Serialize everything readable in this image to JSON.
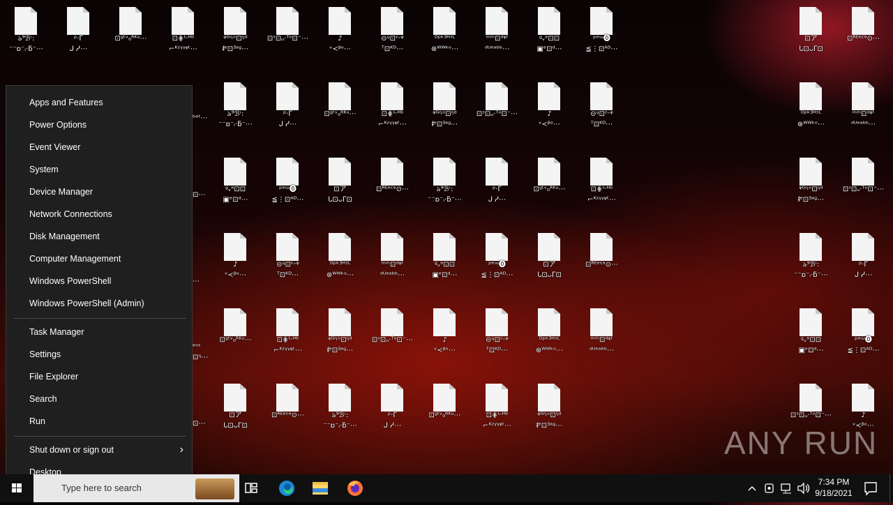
{
  "desktop": {
    "files": [
      {
        "label": "ঌ⁹ℬᶥ:\n⁻⁻ɒ⁻ᵢ·ƃ⁻⋯"
      },
      {
        "label": "ᵖ·ᒥ\nᒍ ᓱ⋯"
      },
      {
        "label": "⊡ᶢᵗᵛ₀ᴿᴷᵘ⋯"
      },
      {
        "label": "⊡⋕ᴵᵕᴴᵇ\n⌐ᴷᶻᵞᵞᵠᵗ⋯"
      },
      {
        "label": "ᵠᴳᶯᵒ⊡ᵑᵈ\nᵮᵉ⊡ᴲᵃᶢ⋯"
      },
      {
        "label": "⊡ᵌ⊡ᵤ·ᵀᵒ⊡⁻⋯"
      },
      {
        "label": "♪\nᵛ≺ᵝᵒ⋯"
      },
      {
        "label": "⊝ᶣ⊡ᵋᵕᵠ\nᵀ⊡ᴷᴰ⋯"
      },
      {
        "label": "ᴰᵖᵏᴲᴴᵌᴸ\n⊛ᵂᵂᵏᵒ⋯"
      },
      {
        "label": "ᵐᵐ⊡ᵈᵠᵗ\nᵈᵁᵉᵃᵇᵇ⋯"
      },
      {
        "label": "ᵍᵥᵊ⊡⊡\n▣ᵉ⊡ᵈ⋯"
      },
      {
        "label": "ᵖᵉᵚ⓿\n≦⋮⊡ᴬᴰ⋯"
      },
      {
        "label": "⊡ア\nᒐ⊡ᴗᒥ⊡"
      },
      {
        "label": "⊡ᴿᴱᵉᵋᵊ⊙⋯"
      }
    ],
    "overlapped_labels": [
      "ᵇᵊᵗ⋯",
      "⊡⋯",
      "⋯",
      "ᵉᵒᵋ\n⊡ᵑ⋯",
      "⊡⋯"
    ]
  },
  "start_menu": {
    "items": [
      {
        "label": "Apps and Features"
      },
      {
        "label": "Power Options"
      },
      {
        "label": "Event Viewer"
      },
      {
        "label": "System"
      },
      {
        "label": "Device Manager"
      },
      {
        "label": "Network Connections"
      },
      {
        "label": "Disk Management"
      },
      {
        "label": "Computer Management"
      },
      {
        "label": "Windows PowerShell"
      },
      {
        "label": "Windows PowerShell (Admin)"
      },
      {
        "label": "Task Manager"
      },
      {
        "label": "Settings"
      },
      {
        "label": "File Explorer"
      },
      {
        "label": "Search"
      },
      {
        "label": "Run"
      },
      {
        "label": "Shut down or sign out"
      },
      {
        "label": "Desktop"
      }
    ]
  },
  "taskbar": {
    "search_placeholder": "Type here to search",
    "time": "7:34 PM",
    "date": "9/18/2021"
  },
  "watermark": "ANY RUN",
  "colors": {
    "menu_bg": "#1f1f1f",
    "taskbar_bg": "#101010",
    "accent": "#0078d4"
  }
}
